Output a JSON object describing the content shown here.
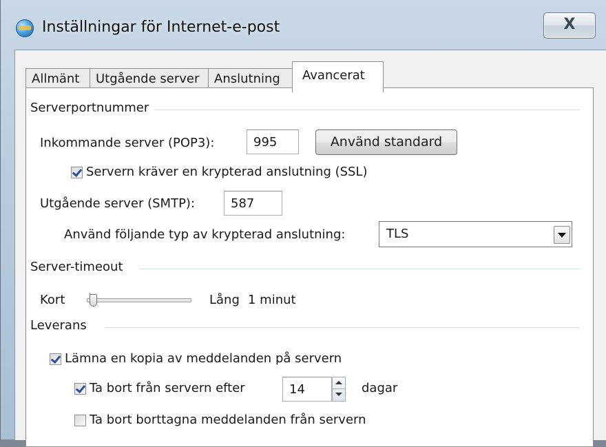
{
  "window": {
    "title": "Inställningar för Internet-e-post",
    "close_glyph": "X"
  },
  "tabs": [
    {
      "label": "Allmänt",
      "active": false
    },
    {
      "label": "Utgående server",
      "active": false
    },
    {
      "label": "Anslutning",
      "active": false
    },
    {
      "label": "Avancerat",
      "active": true
    }
  ],
  "ports": {
    "group_label": "Serverportnummer",
    "incoming_label": "Inkommande server (POP3):",
    "incoming_value": "995",
    "use_default_label": "Använd standard",
    "ssl_label": "Servern kräver en krypterad anslutning (SSL)",
    "ssl_checked": true,
    "outgoing_label": "Utgående server (SMTP):",
    "outgoing_value": "587",
    "encryption_label": "Använd följande typ av krypterad anslutning:",
    "encryption_value": "TLS"
  },
  "timeout": {
    "group_label": "Server-timeout",
    "short_label": "Kort",
    "long_label": "Lång",
    "value_text": "1 minut",
    "level": 0.0
  },
  "delivery": {
    "group_label": "Leverans",
    "leave_copy_label": "Lämna en kopia av meddelanden på servern",
    "leave_copy_checked": true,
    "remove_after_label": "Ta bort från servern efter",
    "remove_after_checked": true,
    "days_value": "14",
    "days_unit": "dagar",
    "remove_deleted_label": "Ta bort borttagna meddelanden från servern",
    "remove_deleted_checked": false
  },
  "icons": {
    "app": "mail-settings-icon",
    "close": "close-icon"
  }
}
